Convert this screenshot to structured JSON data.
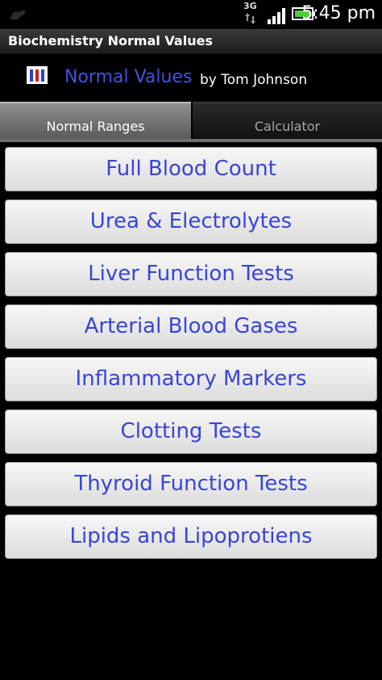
{
  "status_bar": {
    "network_type": "3G",
    "time": "5:45 pm",
    "icons": {
      "left": "android-icon",
      "network_arrows": "data-arrows-icon",
      "signal": "signal-icon",
      "battery": "battery-icon"
    }
  },
  "app": {
    "title": "Biochemistry Normal Values"
  },
  "header": {
    "logo_icon": "bar-logo-icon",
    "title": "Normal Values",
    "author": "by Tom Johnson"
  },
  "tabs": [
    {
      "label": "Normal Ranges",
      "active": true
    },
    {
      "label": "Calculator",
      "active": false
    }
  ],
  "buttons": [
    {
      "label": "Full Blood Count"
    },
    {
      "label": "Urea & Electrolytes"
    },
    {
      "label": "Liver Function Tests"
    },
    {
      "label": "Arterial Blood Gases"
    },
    {
      "label": "Inflammatory Markers"
    },
    {
      "label": "Clotting Tests"
    },
    {
      "label": "Thyroid Function Tests"
    },
    {
      "label": "Lipids and Lipoprotiens"
    }
  ],
  "colors": {
    "accent_text": "#3a44d8",
    "header_title": "#4650e0",
    "battery_fill": "#4fcf3a"
  }
}
